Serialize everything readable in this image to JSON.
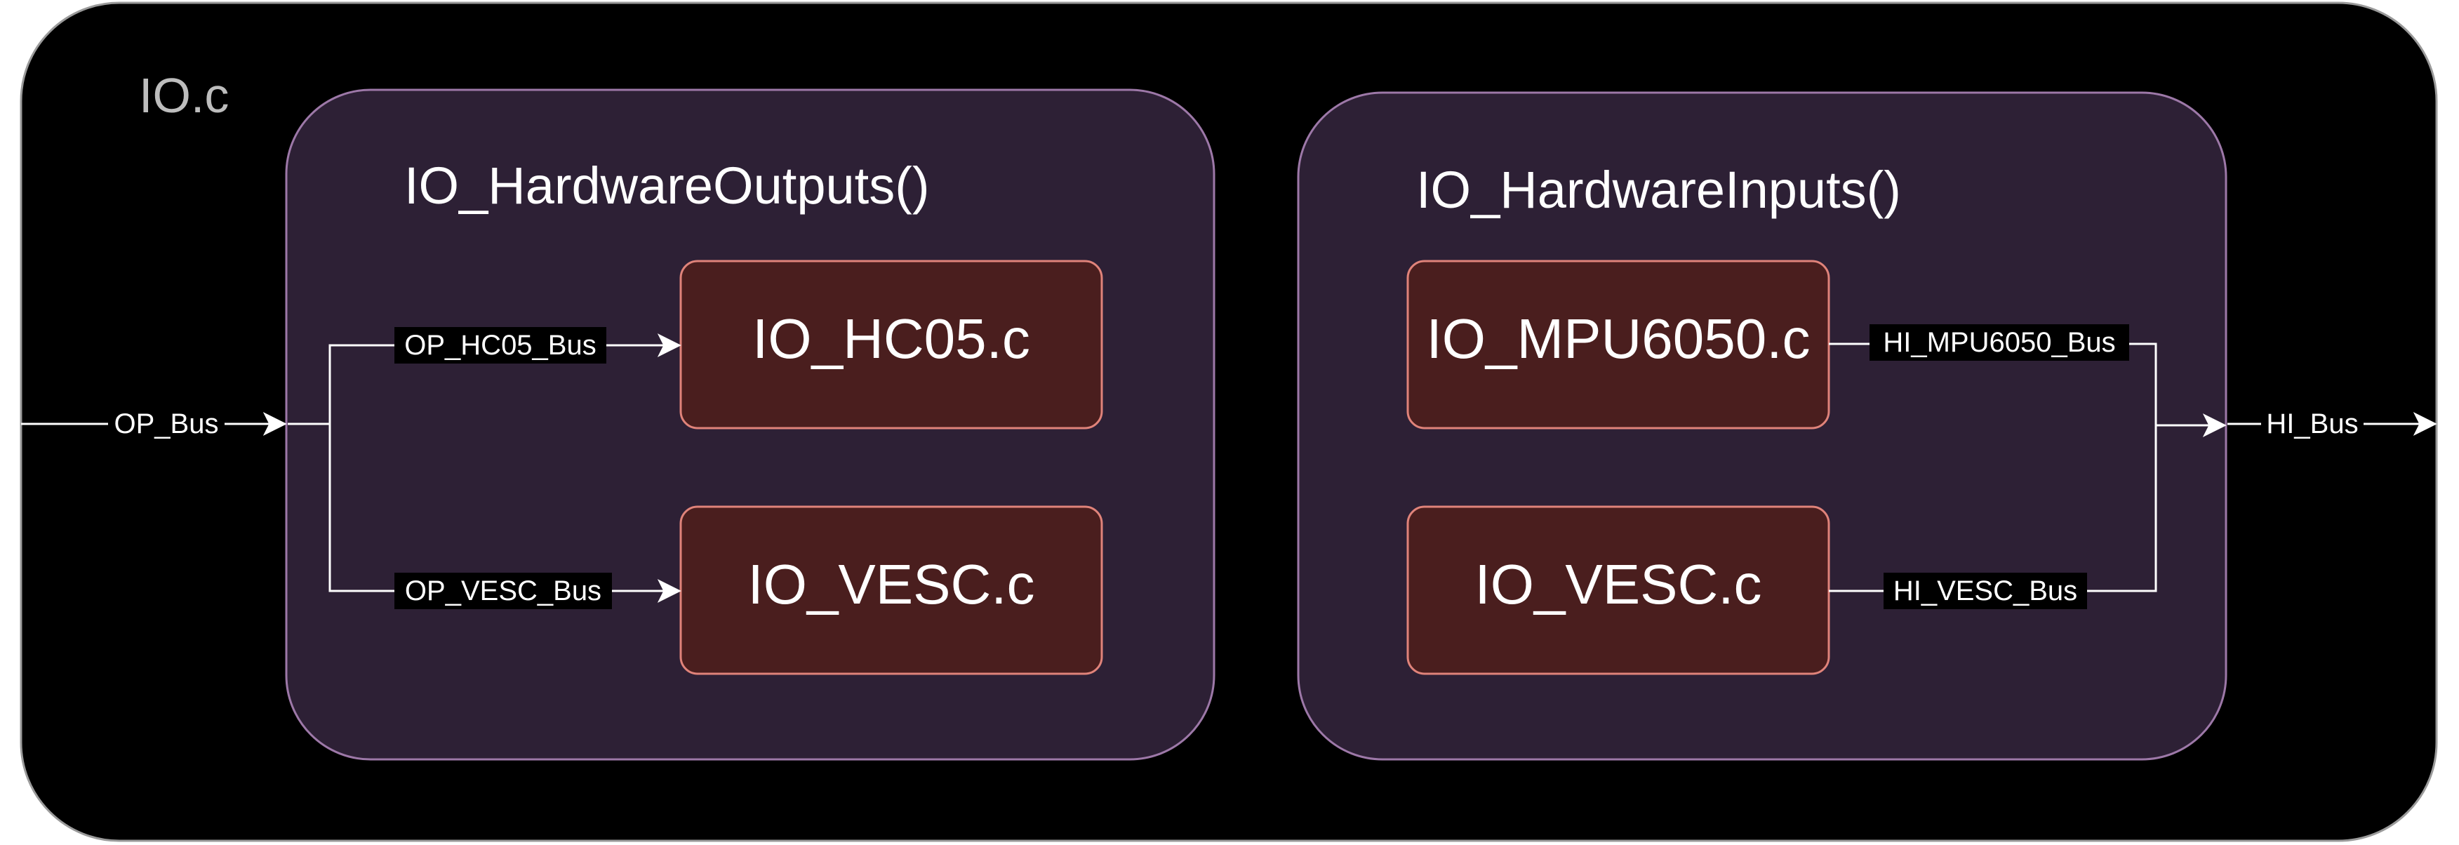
{
  "outer": {
    "title": "IO.c"
  },
  "groups": {
    "outputs": {
      "title": "IO_HardwareOutputs()"
    },
    "inputs": {
      "title": "IO_HardwareInputs()"
    }
  },
  "modules": {
    "hc05": {
      "label": "IO_HC05.c"
    },
    "vesc_out": {
      "label": "IO_VESC.c"
    },
    "mpu6050": {
      "label": "IO_MPU6050.c"
    },
    "vesc_in": {
      "label": "IO_VESC.c"
    }
  },
  "buses": {
    "op_bus": "OP_Bus",
    "op_hc05_bus": "OP_HC05_Bus",
    "op_vesc_bus": "OP_VESC_Bus",
    "hi_mpu6050_bus": "HI_MPU6050_Bus",
    "hi_vesc_bus": "HI_VESC_Bus",
    "hi_bus": "HI_Bus"
  },
  "colors": {
    "outer_fill": "#000000",
    "outer_stroke": "#9a9a9a",
    "group_fill": "#2d2035",
    "group_stroke": "#9d78a8",
    "module_fill": "#4a1e1e",
    "module_stroke": "#e0837a",
    "line": "#ffffff",
    "title_outer": "#bdbdbd",
    "text": "#ffffff"
  }
}
